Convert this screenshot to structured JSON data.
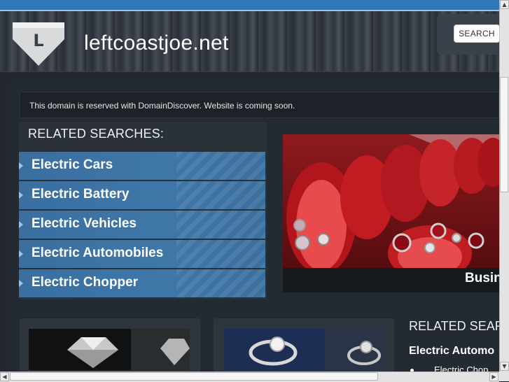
{
  "header": {
    "logo_letter": "L",
    "site_title": "leftcoastjoe.net",
    "search_button": "SEARCH"
  },
  "notice": "This domain is reserved with DomainDiscover. Website is coming soon.",
  "related_searches": {
    "title": "RELATED SEARCHES:",
    "items": [
      {
        "label": "Electric Cars"
      },
      {
        "label": "Electric Battery"
      },
      {
        "label": "Electric Vehicles"
      },
      {
        "label": "Electric Automobiles"
      },
      {
        "label": "Electric Chopper"
      }
    ]
  },
  "hero": {
    "caption": "Busin"
  },
  "related_searches_2": {
    "title": "RELATED SEAR",
    "item": "Electric Automo",
    "sub_item": "Electric Chop"
  },
  "colors": {
    "accent_blue": "#3f77a9",
    "background": "#232830"
  },
  "icons": {
    "scroll_up": "chevron-up-icon",
    "scroll_down": "chevron-down-icon",
    "scroll_left": "chevron-left-icon",
    "scroll_right": "chevron-right-icon"
  }
}
